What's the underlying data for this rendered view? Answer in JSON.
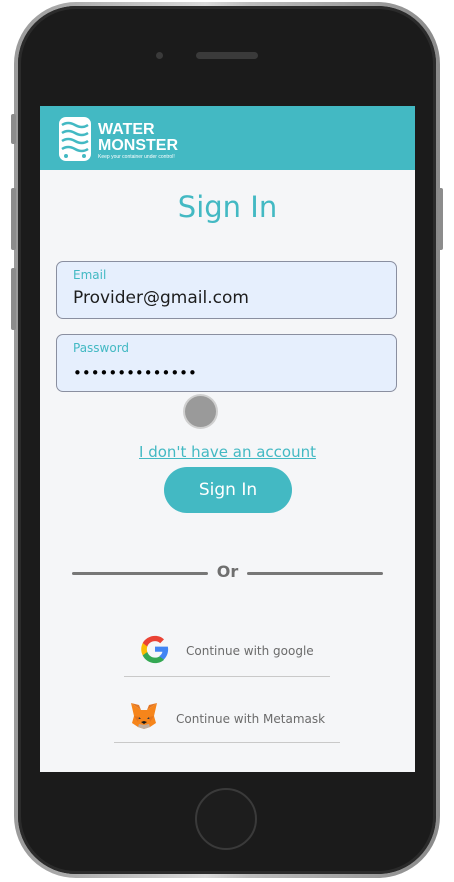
{
  "header": {
    "brand_name": "WATER\nMONSTER",
    "tagline": "Keep your container under control!",
    "logo_icon": "water-container-icon"
  },
  "page": {
    "title": "Sign In"
  },
  "form": {
    "email_label": "Email",
    "email_value": "Provider@gmail.com",
    "password_label": "Password",
    "password_value": "••••••••••••••"
  },
  "links": {
    "no_account": "I don't have an account"
  },
  "buttons": {
    "sign_in": "Sign In"
  },
  "divider": {
    "text": "Or"
  },
  "social": {
    "google": "Continue with google",
    "metamask": "Continue with Metamask"
  },
  "colors": {
    "accent": "#43b9c3",
    "field_bg": "#e6effd"
  }
}
